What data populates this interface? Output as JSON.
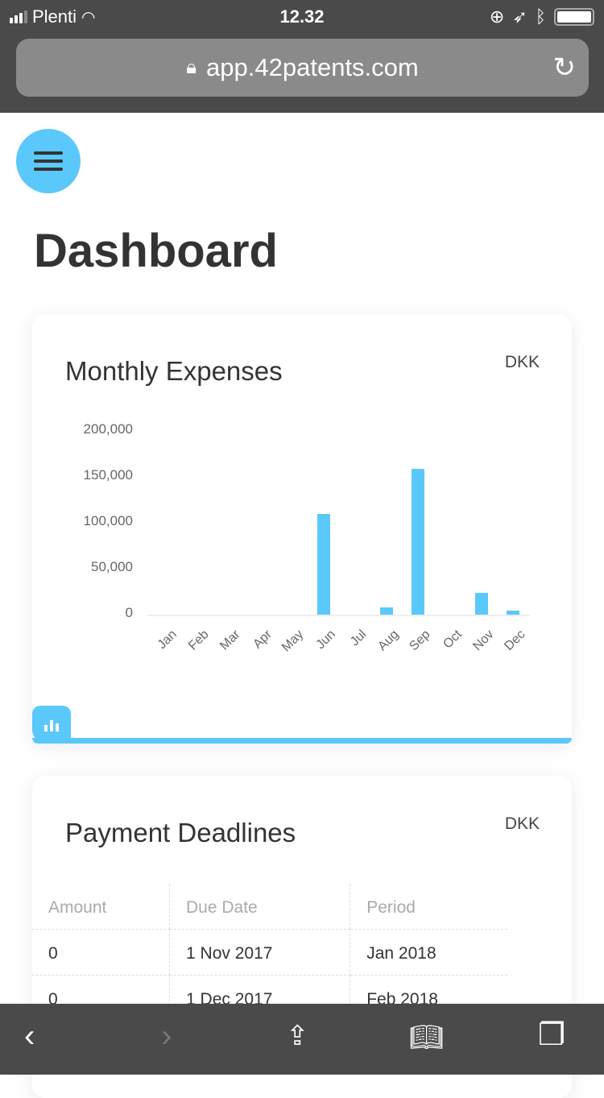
{
  "status_bar": {
    "carrier": "Plenti",
    "time": "12.32"
  },
  "browser": {
    "url": "app.42patents.com"
  },
  "page": {
    "title": "Dashboard"
  },
  "expenses_card": {
    "title": "Monthly Expenses",
    "currency": "DKK"
  },
  "chart_data": {
    "type": "bar",
    "title": "Monthly Expenses",
    "ylabel": "DKK",
    "categories": [
      "Jan",
      "Feb",
      "Mar",
      "Apr",
      "May",
      "Jun",
      "Jul",
      "Aug",
      "Sep",
      "Oct",
      "Nov",
      "Dec"
    ],
    "values": [
      0,
      0,
      0,
      0,
      0,
      110000,
      0,
      8000,
      159000,
      0,
      24000,
      4000
    ],
    "ylim": [
      0,
      200000
    ],
    "yticks": [
      "200,000",
      "150,000",
      "100,000",
      "50,000",
      "0"
    ],
    "color": "#5bc8fb"
  },
  "deadlines_card": {
    "title": "Payment Deadlines",
    "currency": "DKK",
    "columns": [
      "Amount",
      "Due Date",
      "Period"
    ],
    "rows": [
      [
        "0",
        "1 Nov 2017",
        "Jan 2018"
      ],
      [
        "0",
        "1 Dec 2017",
        "Feb 2018"
      ]
    ]
  }
}
